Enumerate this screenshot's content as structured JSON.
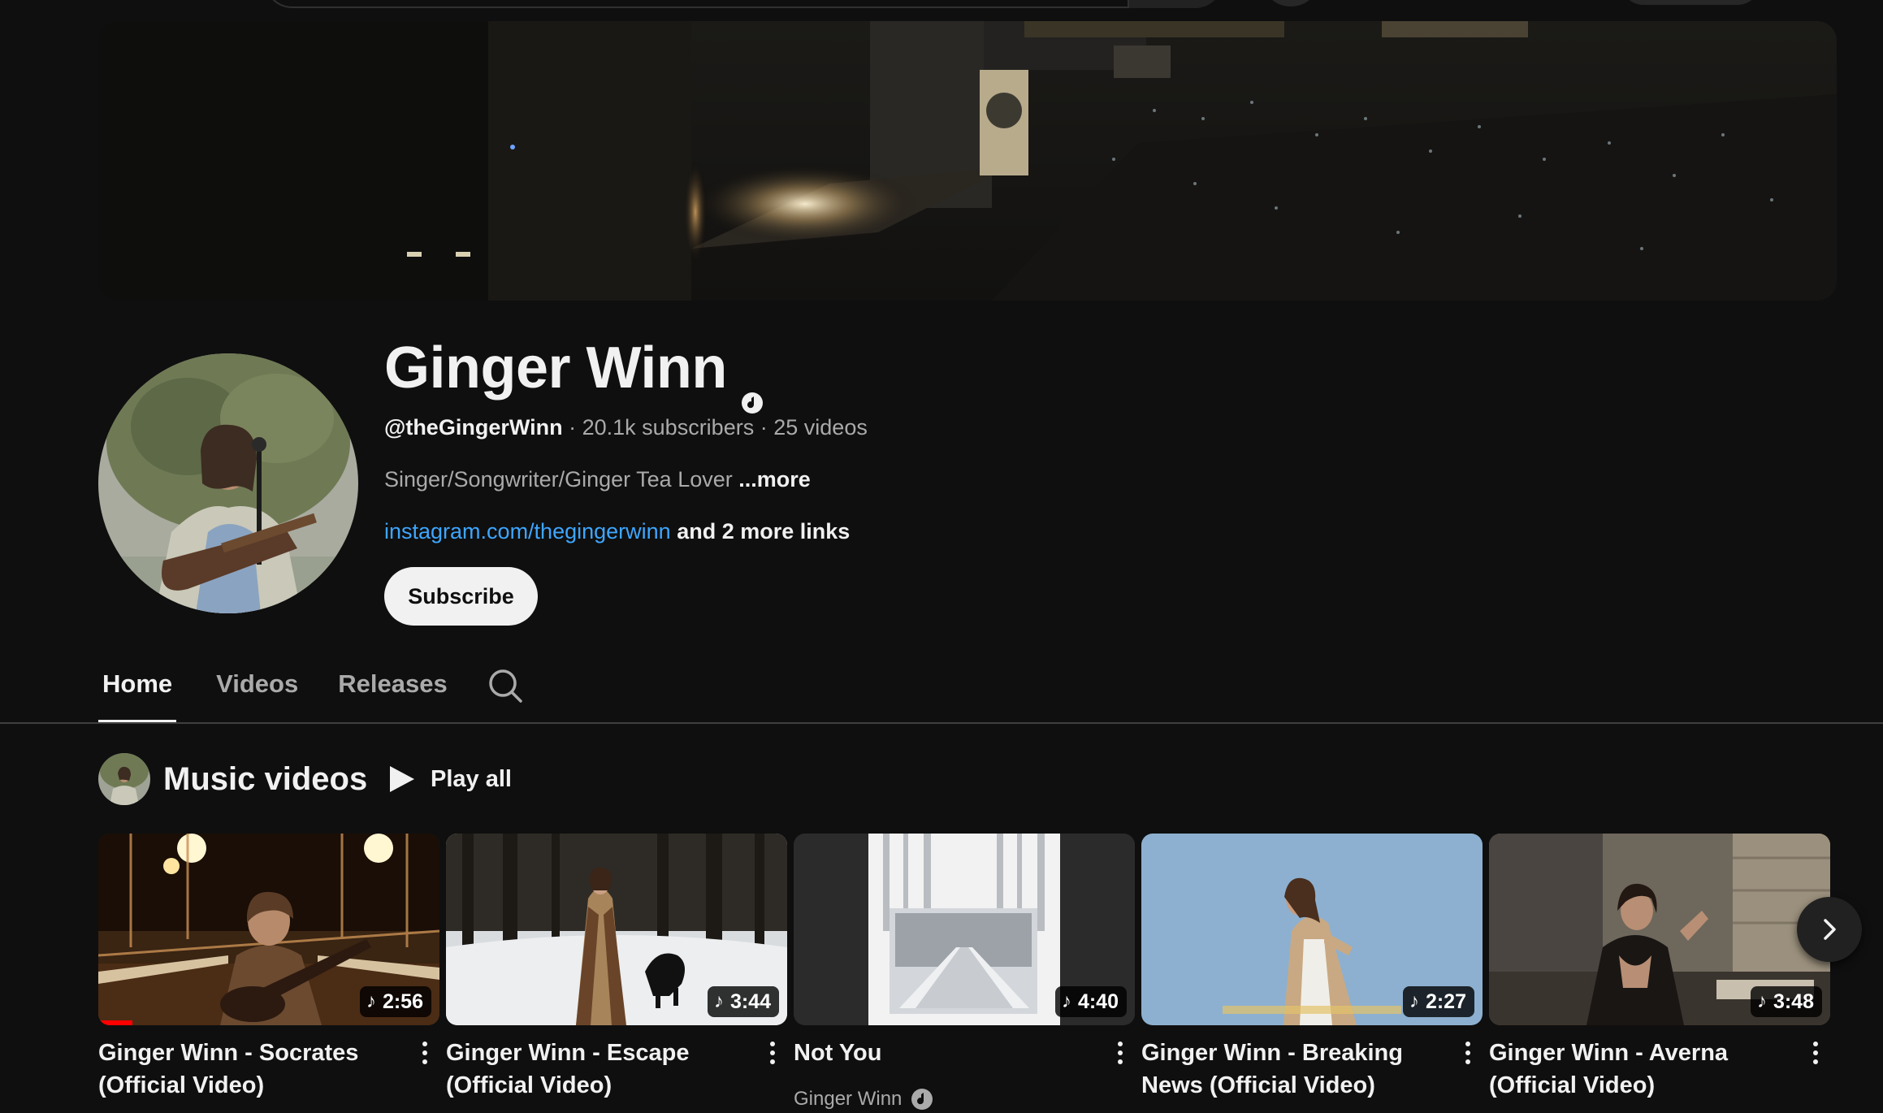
{
  "channel": {
    "name": "Ginger Winn",
    "handle": "@theGingerWinn",
    "subscribers": "20.1k subscribers",
    "videos_count": "25 videos",
    "separator": "·",
    "description": "Singer/Songwriter/Ginger Tea Lover",
    "description_more": "...more",
    "link": "instagram.com/thegingerwinn",
    "more_links": "and 2 more links",
    "subscribe_label": "Subscribe"
  },
  "tabs": [
    {
      "label": "Home",
      "active": true
    },
    {
      "label": "Videos",
      "active": false
    },
    {
      "label": "Releases",
      "active": false
    }
  ],
  "section": {
    "title": "Music videos",
    "play_all": "Play all"
  },
  "videos": [
    {
      "title": "Ginger Winn - Socrates (Official Video)",
      "duration": "2:56",
      "watched_fraction": 0.1
    },
    {
      "title": "Ginger Winn - Escape (Official Video)",
      "duration": "3:44"
    },
    {
      "title": "Not You",
      "duration": "4:40",
      "channel": "Ginger Winn"
    },
    {
      "title": "Ginger Winn - Breaking News (Official Video)",
      "duration": "2:27"
    },
    {
      "title": "Ginger Winn - Averna (Official Video)",
      "duration": "3:48"
    }
  ],
  "icons": {
    "verified": "music-note-verified-icon",
    "search": "search-icon",
    "play": "play-icon",
    "more": "more-vert-icon",
    "next": "chevron-right-icon",
    "duration_badge": "music-note-icon"
  },
  "colors": {
    "background": "#0f0f0f",
    "link": "#3ea6ff",
    "progress": "#ff0000",
    "secondary_text": "#aaaaaa"
  }
}
